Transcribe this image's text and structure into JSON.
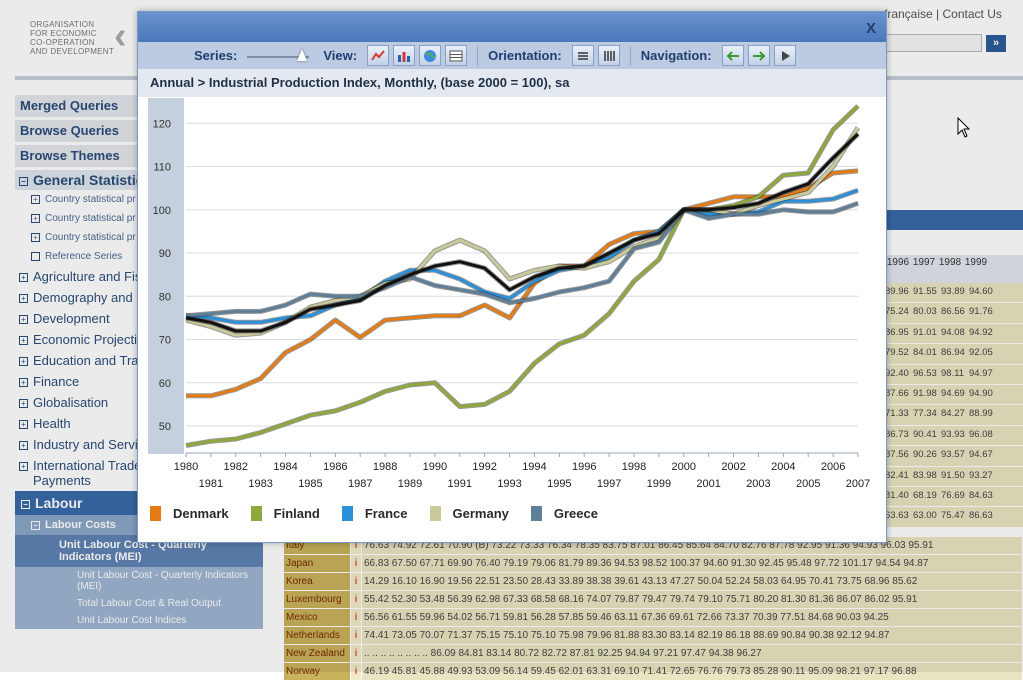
{
  "page": {
    "org_name": [
      "ORGANISATION",
      "FOR ECONOMIC",
      "CO-OPERATION",
      "AND DEVELOPMENT"
    ],
    "top_links": [
      "française",
      "Contact Us"
    ],
    "search_go": "»",
    "tabs": [
      "Merged Queries",
      "Browse Queries",
      "Browse Themes"
    ],
    "general_statistics": "General Statistics",
    "sub_items": [
      "Country statistical pr",
      "Country statistical pr",
      "Country statistical pr"
    ],
    "reference_series": "Reference Series",
    "themes": [
      "Agriculture and Fis",
      "Demography and P",
      "Development",
      "Economic Projectio",
      "Education and Trai",
      "Finance",
      "Globalisation",
      "Health",
      "Industry and Servic",
      "International Trade",
      "Payments"
    ],
    "labour": "Labour",
    "labour_costs": "Labour Costs",
    "ulc_quarterly": "Unit Labour Cost - Quarterly Indicators (MEI)",
    "leaf_items": [
      "Unit Labour Cost - Quarterly Indicators (MEI)",
      "Total Labour Cost & Real Output",
      "Unit Labour Cost Indices"
    ],
    "year_headers": [
      "1996",
      "1997",
      "1998",
      "1999"
    ],
    "year_rows": [
      [
        "89.96",
        "91.55",
        "93.89",
        "94.60"
      ],
      [
        "75.24",
        "80.03",
        "86.56",
        "91.76"
      ],
      [
        "86.95",
        "91.01",
        "94.08",
        "94.92"
      ],
      [
        "79.52",
        "84.01",
        "86.94",
        "92.05"
      ],
      [
        "92.40",
        "96.53",
        "98.11",
        "94.97"
      ],
      [
        "87.66",
        "91.98",
        "94.69",
        "94.90"
      ],
      [
        "71.33",
        "77.34",
        "84.27",
        "88.99"
      ],
      [
        "86.73",
        "90.41",
        "93.93",
        "96.08"
      ],
      [
        "87.56",
        "90.26",
        "93.57",
        "94.67"
      ],
      [
        "82.41",
        "83.98",
        "91.50",
        "93.27"
      ],
      [
        "81.40",
        "68.19",
        "76.69",
        "84.63"
      ],
      [
        "63.63",
        "63.00",
        "75.47",
        "86.63"
      ]
    ],
    "table_rows": [
      {
        "country": "Italy",
        "values": "76.63 74.92 72.61 70.90 (B) 73.22 73.33 76.34 78.35 83.75 87.01 86.45 85.64 84.70 82.76 87.78 92.95 91.36 94.93 96.03 95.91"
      },
      {
        "country": "Japan",
        "values": "66.83 67.50 67.71 69.90 76.40 79.19 79.06 81.79 89.36 94.53 98.52 100.37 94.60 91.30 92.45 95.48 97.72 101.17 94.54 94.87"
      },
      {
        "country": "Korea",
        "values": "14.29 16.10 16.90 19.56 22.51 23.50 28.43 33.89 38.38 39.61 43.13 47.27 50.04 52.24 58.03 64.95 70.41 73.75 68.96 85.62"
      },
      {
        "country": "Luxembourg",
        "values": "55.42 52.30 53.48 56.39 62.98 67.33 68.58 68.16 74.07 79.87 79.47 79.74 79.10 75.71 80.20 81.30 81.36 86.07 86.02 95.91"
      },
      {
        "country": "Mexico",
        "values": "56.56 61.55 59.96 54.02 56.71 59.81 56.28 57.85 59.46 63.11 67.36 69.61 72.66 73.37 70.39 77.51 84.68 90.03 94.25"
      },
      {
        "country": "Netherlands",
        "values": "74.41 73.05 70.07 71.37 75.15 75.10 75.10 75.98 79.96 81.88 83.30 83.14 82.19 86.18 88.69 90.84 90.38 92.12 94.87"
      },
      {
        "country": "New Zealand",
        "values": ".. .. .. .. .. .. .. .. 86.09 84.81 83.14 80.72 82.72 87.81 92.25 94.94 97.21 97.47 94.38 96.27"
      },
      {
        "country": "Norway",
        "values": "46.19 45.81 45.88 49.93 53.09 56.14 59.45 62.01 63.31 69.10 71.41 72.65 76.76 79.73 85.28 90.11 95.09 98.21 97.17 96.88"
      }
    ]
  },
  "dialog": {
    "close_label": "X",
    "series_label": "Series:",
    "view_label": "View:",
    "orientation_label": "Orientation:",
    "navigation_label": "Navigation:",
    "subtitle": "Annual > Industrial Production Index, Monthly, (base 2000 = 100), sa",
    "colors": {
      "titlebar": "#5a86c6",
      "toolbar": "#bccbe2",
      "subtitle_bg": "#e4e9f1"
    }
  },
  "chart_data": {
    "type": "line",
    "title": "",
    "xlabel": "",
    "ylabel": "",
    "x": [
      1980,
      1981,
      1982,
      1983,
      1984,
      1985,
      1986,
      1987,
      1988,
      1989,
      1990,
      1991,
      1992,
      1993,
      1994,
      1995,
      1996,
      1997,
      1998,
      1999,
      2000,
      2001,
      2002,
      2003,
      2004,
      2005,
      2006,
      2007
    ],
    "ylim": [
      44,
      124
    ],
    "yticks": [
      50,
      60,
      70,
      80,
      90,
      100,
      110,
      120
    ],
    "grid": true,
    "legend_position": "bottom",
    "series": [
      {
        "name": "Denmark",
        "color": "#e57c13",
        "values": [
          57,
          57,
          58.5,
          61,
          67,
          70,
          74.5,
          70.5,
          74.5,
          75,
          75.5,
          75.5,
          78,
          75,
          83,
          87,
          87,
          92,
          94.5,
          95,
          100,
          101.5,
          103,
          103,
          103,
          105,
          108.5,
          109
        ]
      },
      {
        "name": "Finland",
        "color": "#8fa83c",
        "values": [
          45.5,
          46.5,
          47,
          48.5,
          50.5,
          52.5,
          53.5,
          55.5,
          58,
          59.5,
          60,
          54.5,
          55,
          58,
          64.5,
          69,
          71,
          76,
          83.5,
          88.5,
          100,
          100,
          101,
          103,
          108,
          108.5,
          118.5,
          124
        ]
      },
      {
        "name": "France",
        "color": "#2b90d8",
        "values": [
          75.5,
          75,
          74,
          74,
          75,
          75.5,
          78,
          79.5,
          83.5,
          86,
          86,
          84,
          81,
          79.5,
          83.5,
          86,
          87,
          89,
          93,
          95,
          100,
          99,
          99,
          99.5,
          102,
          102,
          102.5,
          104.5
        ]
      },
      {
        "name": "Germany",
        "color": "#c9c99a",
        "values": [
          74.5,
          73,
          71,
          71.5,
          74,
          77.5,
          79,
          80,
          83,
          84,
          90.5,
          93,
          90.5,
          84,
          86,
          87,
          86.5,
          88,
          91.5,
          93.5,
          100,
          100,
          99,
          101,
          102.5,
          104,
          110,
          119
        ]
      },
      {
        "name": "Greece",
        "color": "#5f7f98",
        "values": [
          75.5,
          76,
          76.5,
          76.5,
          78,
          80.5,
          80,
          80,
          82,
          84.5,
          82.5,
          81.5,
          80.5,
          78.5,
          79.5,
          81,
          82,
          83.5,
          91,
          92.5,
          100,
          98,
          99,
          99,
          100,
          99.5,
          99.5,
          101.5
        ]
      },
      {
        "name": "",
        "color": "#111111",
        "values": [
          75,
          74,
          72,
          72,
          74,
          77,
          78,
          79,
          82.5,
          85,
          87,
          88,
          86.5,
          81.5,
          84.5,
          86.5,
          87,
          90,
          93,
          94.5,
          100,
          100,
          100.5,
          101.5,
          104,
          106,
          112,
          117.5
        ]
      }
    ]
  }
}
